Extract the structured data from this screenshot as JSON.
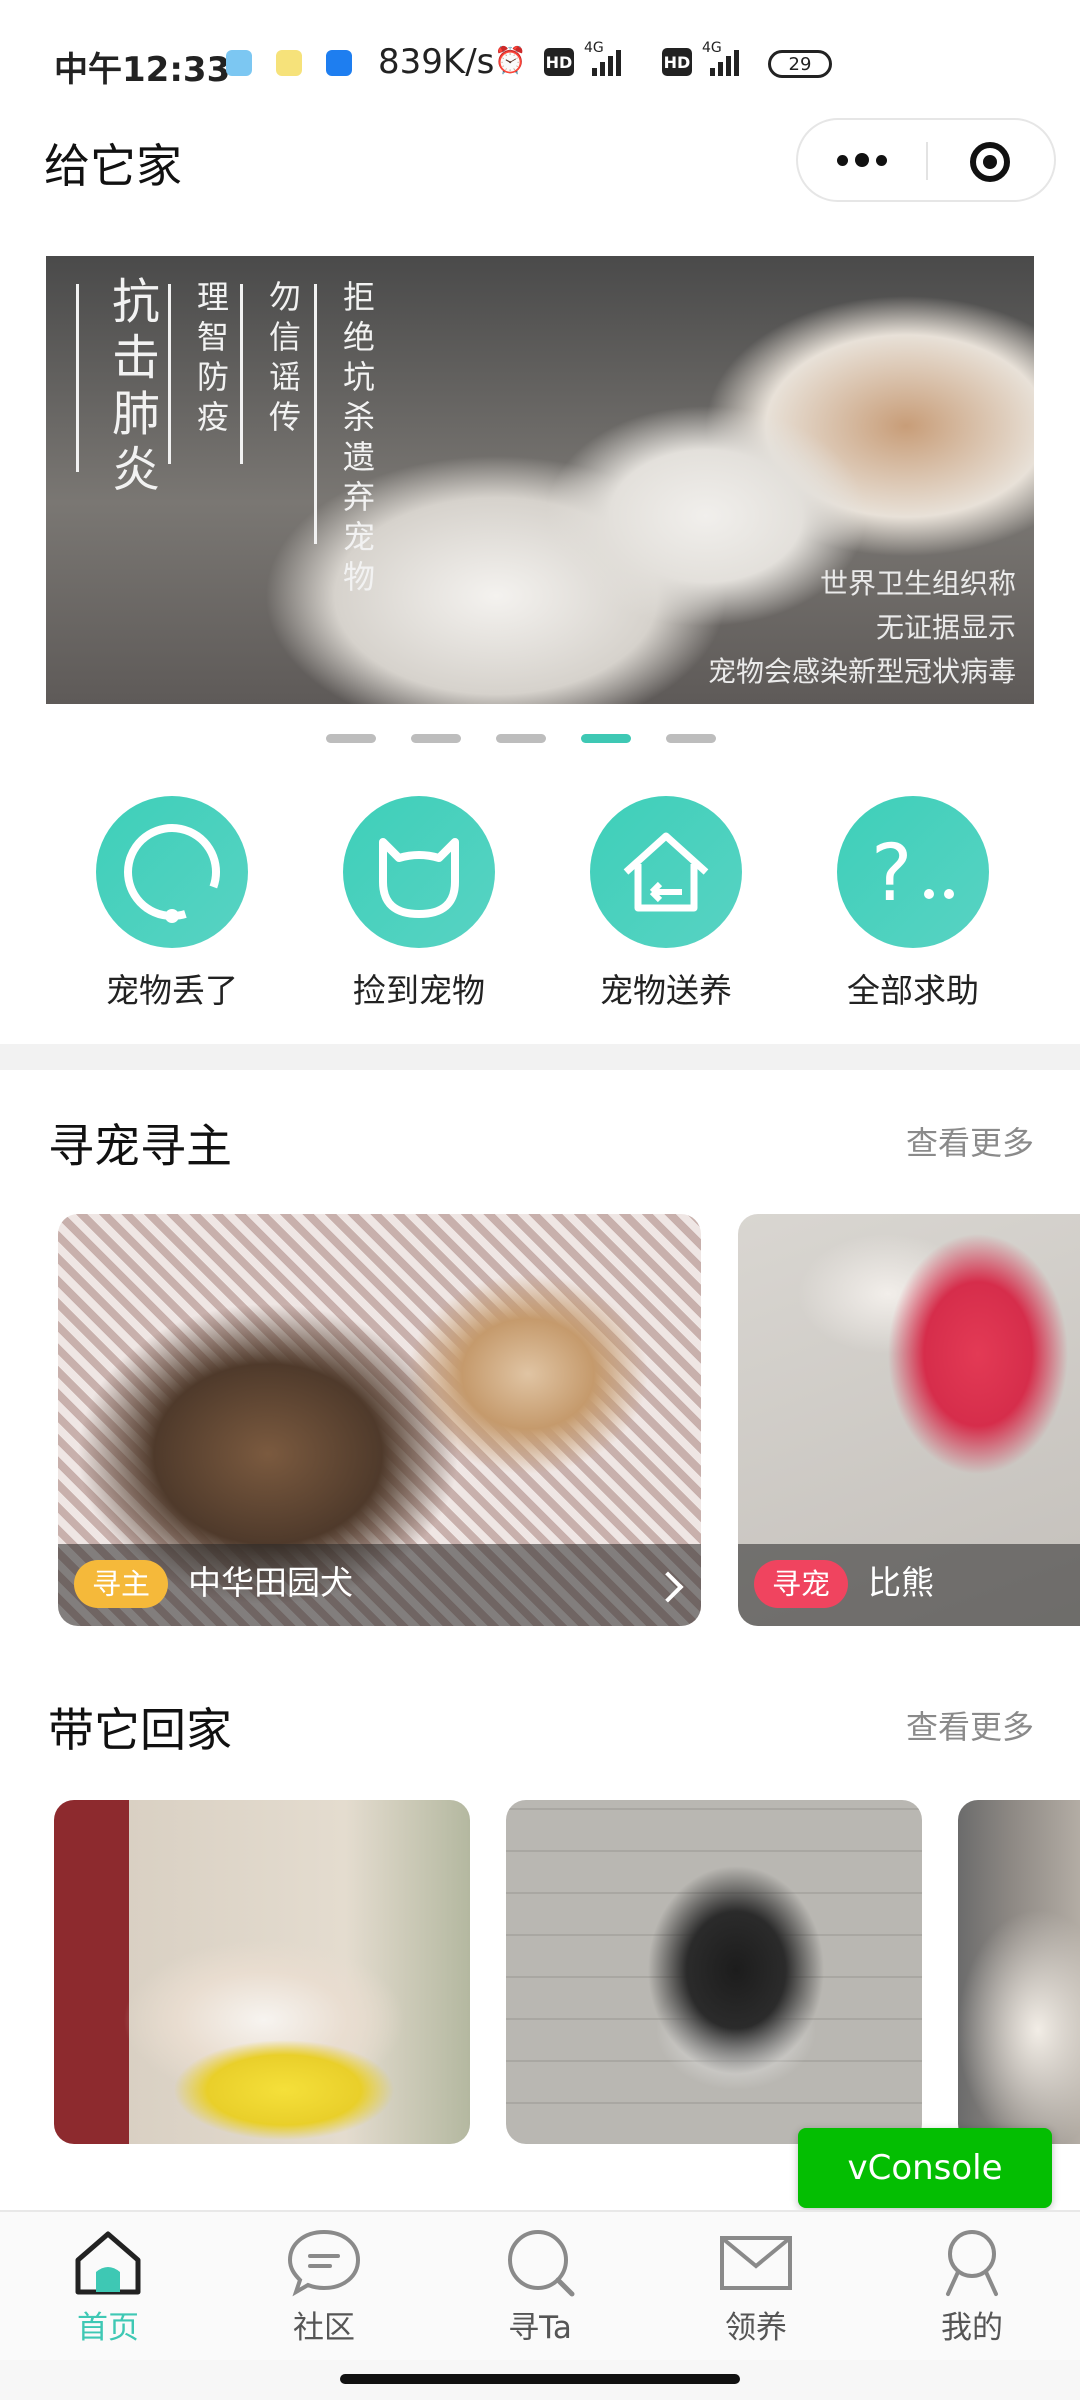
{
  "status_bar": {
    "time": "中午12:33",
    "net_speed": "839K/s",
    "hd1": "HD",
    "net1": "4G",
    "hd2": "HD",
    "net2": "4G",
    "battery": "29"
  },
  "titlebar": {
    "title": "给它家",
    "more_icon": "more-dots-icon",
    "close_icon": "target-close-icon"
  },
  "banner": {
    "headline": "抗击肺炎",
    "col1": "理智防疫",
    "col2": "勿信谣传",
    "col3": "拒绝坑杀遗弃宠物",
    "caption_lines": [
      "世界卫生组织称",
      "无证据显示",
      "宠物会感染新型冠状病毒"
    ],
    "active_index": 3,
    "dot_count": 5
  },
  "quick_actions": [
    {
      "label": "宠物丢了",
      "icon": "lost-pet-icon"
    },
    {
      "label": "捡到宠物",
      "icon": "cat-face-icon"
    },
    {
      "label": "宠物送养",
      "icon": "house-icon"
    },
    {
      "label": "全部求助",
      "icon": "question-icon"
    }
  ],
  "section_find": {
    "title": "寻宠寻主",
    "more": "查看更多",
    "cards": [
      {
        "tag": "寻主",
        "tag_color": "#f5b93a",
        "name": "中华田园犬"
      },
      {
        "tag": "寻宠",
        "tag_color": "#f0445f",
        "name": "比熊"
      }
    ]
  },
  "section_adopt": {
    "title": "带它回家",
    "more": "查看更多"
  },
  "vconsole": {
    "label": "vConsole"
  },
  "tabbar": {
    "items": [
      {
        "label": "首页",
        "icon": "home-icon",
        "active": true
      },
      {
        "label": "社区",
        "icon": "chat-bubble-icon",
        "active": false
      },
      {
        "label": "寻Ta",
        "icon": "search-icon",
        "active": false
      },
      {
        "label": "领养",
        "icon": "envelope-icon",
        "active": false
      },
      {
        "label": "我的",
        "icon": "user-icon",
        "active": false
      }
    ],
    "accent": "#3ec8b4"
  }
}
